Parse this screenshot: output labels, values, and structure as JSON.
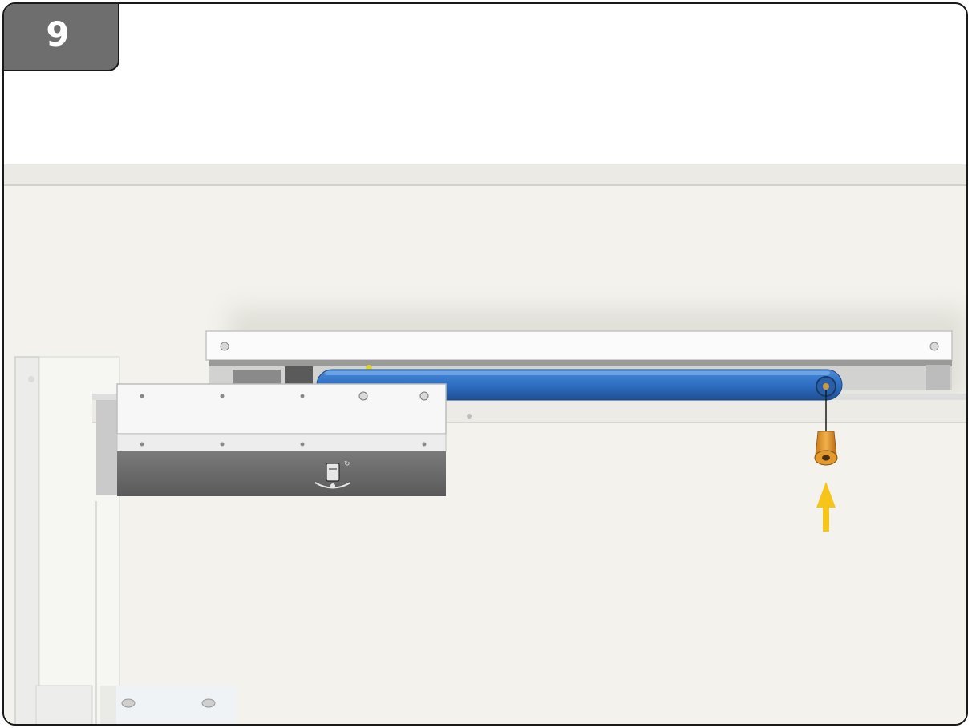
{
  "step": {
    "number": "9"
  },
  "colors": {
    "arm": "#2f6fc4",
    "screw": "#e39a2c",
    "arrow": "#f7c51a",
    "wall": "#f3f2ec",
    "closer_body": "#f4f4f4",
    "closer_cover": "#666666"
  },
  "icons": {
    "arrow": "up-arrow-icon",
    "screw": "screw-icon",
    "adjust": "adjustment-symbol-icon"
  }
}
